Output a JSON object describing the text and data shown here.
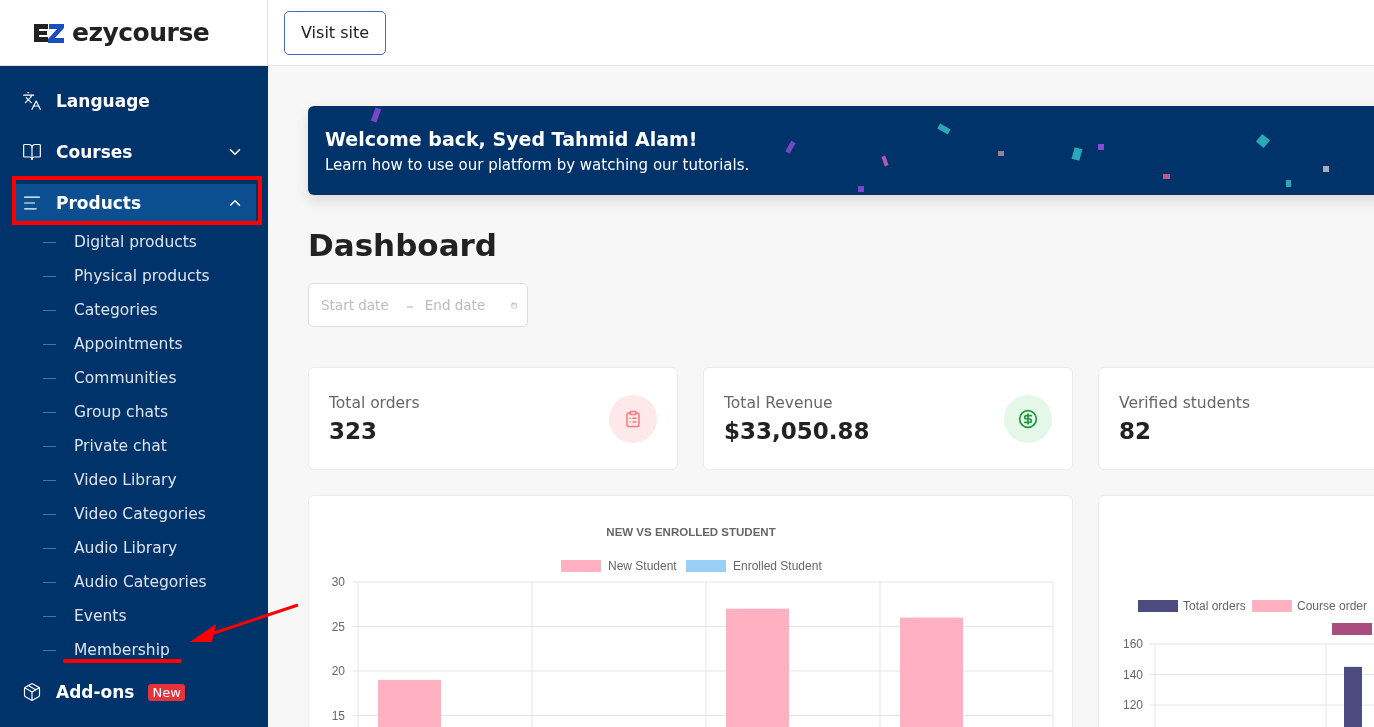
{
  "logo": {
    "text": "ezycourse"
  },
  "header": {
    "button": "Visit site"
  },
  "sidebar": {
    "items": [
      {
        "label": "Language",
        "kind": "language",
        "selected": false
      },
      {
        "label": "Courses",
        "kind": "courses",
        "expanded": false,
        "selected": false
      },
      {
        "label": "Products",
        "kind": "products",
        "expanded": true,
        "selected": true,
        "children": [
          {
            "label": "Digital products"
          },
          {
            "label": "Physical products"
          },
          {
            "label": "Categories"
          },
          {
            "label": "Appointments"
          },
          {
            "label": "Communities"
          },
          {
            "label": "Group chats"
          },
          {
            "label": "Private chat"
          },
          {
            "label": "Video Library"
          },
          {
            "label": "Video Categories"
          },
          {
            "label": "Audio Library"
          },
          {
            "label": "Audio Categories"
          },
          {
            "label": "Events"
          },
          {
            "label": "Membership"
          }
        ]
      },
      {
        "label": "Add-ons",
        "kind": "addons",
        "selected": false,
        "badge": "New"
      }
    ]
  },
  "banner": {
    "title": "Welcome back, Syed Tahmid Alam!",
    "subtitle": "Learn how to use our platform by watching our tutorials."
  },
  "page_title": "Dashboard",
  "date_range": {
    "start_placeholder": "Start date",
    "end_placeholder": "End date"
  },
  "stats": [
    {
      "label": "Total orders",
      "value": "323",
      "kind": "orders"
    },
    {
      "label": "Total Revenue",
      "value": "$33,050.88",
      "kind": "revenue"
    },
    {
      "label": "Verified students",
      "value": "82",
      "kind": "plain"
    }
  ],
  "charts": [
    {
      "chart_data": {
        "type": "bar",
        "title": "NEW VS ENROLLED STUDENT",
        "ylim": [
          15,
          30
        ],
        "yticks": [
          15,
          20,
          25,
          30
        ],
        "series": [
          {
            "name": "New Student",
            "color": "#ffb1c1",
            "values": [
              19,
              null,
              27,
              26
            ]
          },
          {
            "name": "Enrolled Student",
            "color": "#9ad0f5",
            "values": [
              null,
              null,
              null,
              null
            ]
          }
        ]
      }
    },
    {
      "chart_data": {
        "type": "bar",
        "ylim": [
          120,
          160
        ],
        "yticks": [
          120,
          140,
          160
        ],
        "series": [
          {
            "name": "Total orders",
            "color": "#4c4c80",
            "values": [
              null,
              145
            ]
          },
          {
            "name": "Course order",
            "color": "#ffb1c1",
            "values": [
              null,
              null
            ]
          },
          {
            "color": "#a94d7e",
            "values": [
              null,
              null
            ]
          }
        ]
      }
    }
  ]
}
